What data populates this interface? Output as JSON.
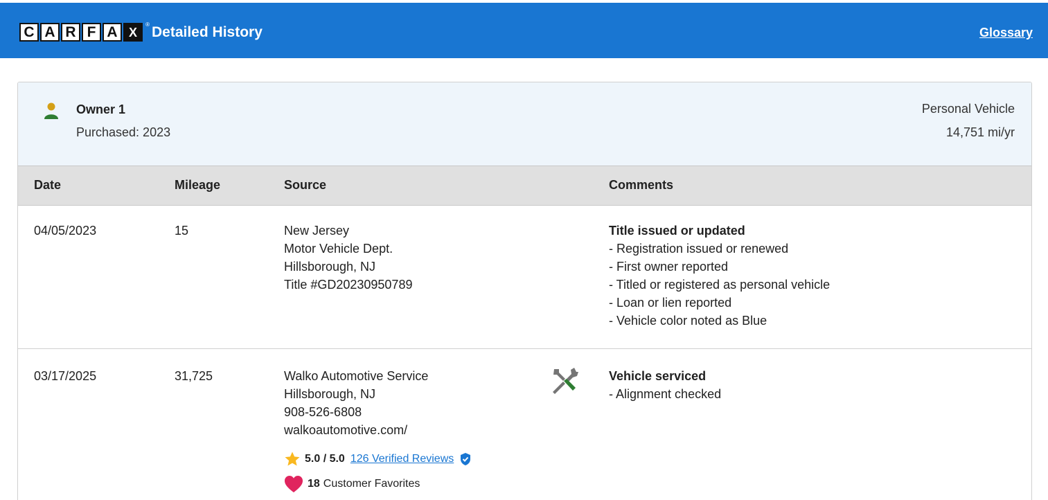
{
  "header": {
    "logo_letters": [
      "C",
      "A",
      "R",
      "F",
      "A",
      "X"
    ],
    "logo_reg": "®",
    "title": "Detailed History",
    "glossary_label": "Glossary",
    "background_color": "#1976d2"
  },
  "owner": {
    "icon": "person-icon",
    "name": "Owner 1",
    "purchased": "Purchased: 2023",
    "vehicle_type": "Personal Vehicle",
    "mileage_per_year": "14,751 mi/yr"
  },
  "table": {
    "headers": {
      "date": "Date",
      "mileage": "Mileage",
      "source": "Source",
      "comments": "Comments"
    },
    "rows": [
      {
        "date": "04/05/2023",
        "mileage": "15",
        "source": [
          "New Jersey",
          "Motor Vehicle Dept.",
          "Hillsborough, NJ",
          "Title #GD20230950789"
        ],
        "comment_title": "Title issued or updated",
        "comment_lines": [
          "Registration issued or renewed",
          "First owner reported",
          "Titled or registered as personal vehicle",
          "Loan or lien reported",
          "Vehicle color noted as Blue"
        ]
      },
      {
        "date": "03/17/2025",
        "mileage": "31,725",
        "source": [
          "Walko Automotive Service",
          "Hillsborough, NJ",
          "908-526-6808",
          "walkoautomotive.com/"
        ],
        "icon": "service-tools-icon",
        "rating": "5.0 / 5.0",
        "reviews_link": "126 Verified Reviews",
        "favorites_count": "18",
        "favorites_label": "Customer Favorites",
        "comment_title": "Vehicle serviced",
        "comment_lines": [
          "Alignment checked"
        ]
      }
    ]
  }
}
